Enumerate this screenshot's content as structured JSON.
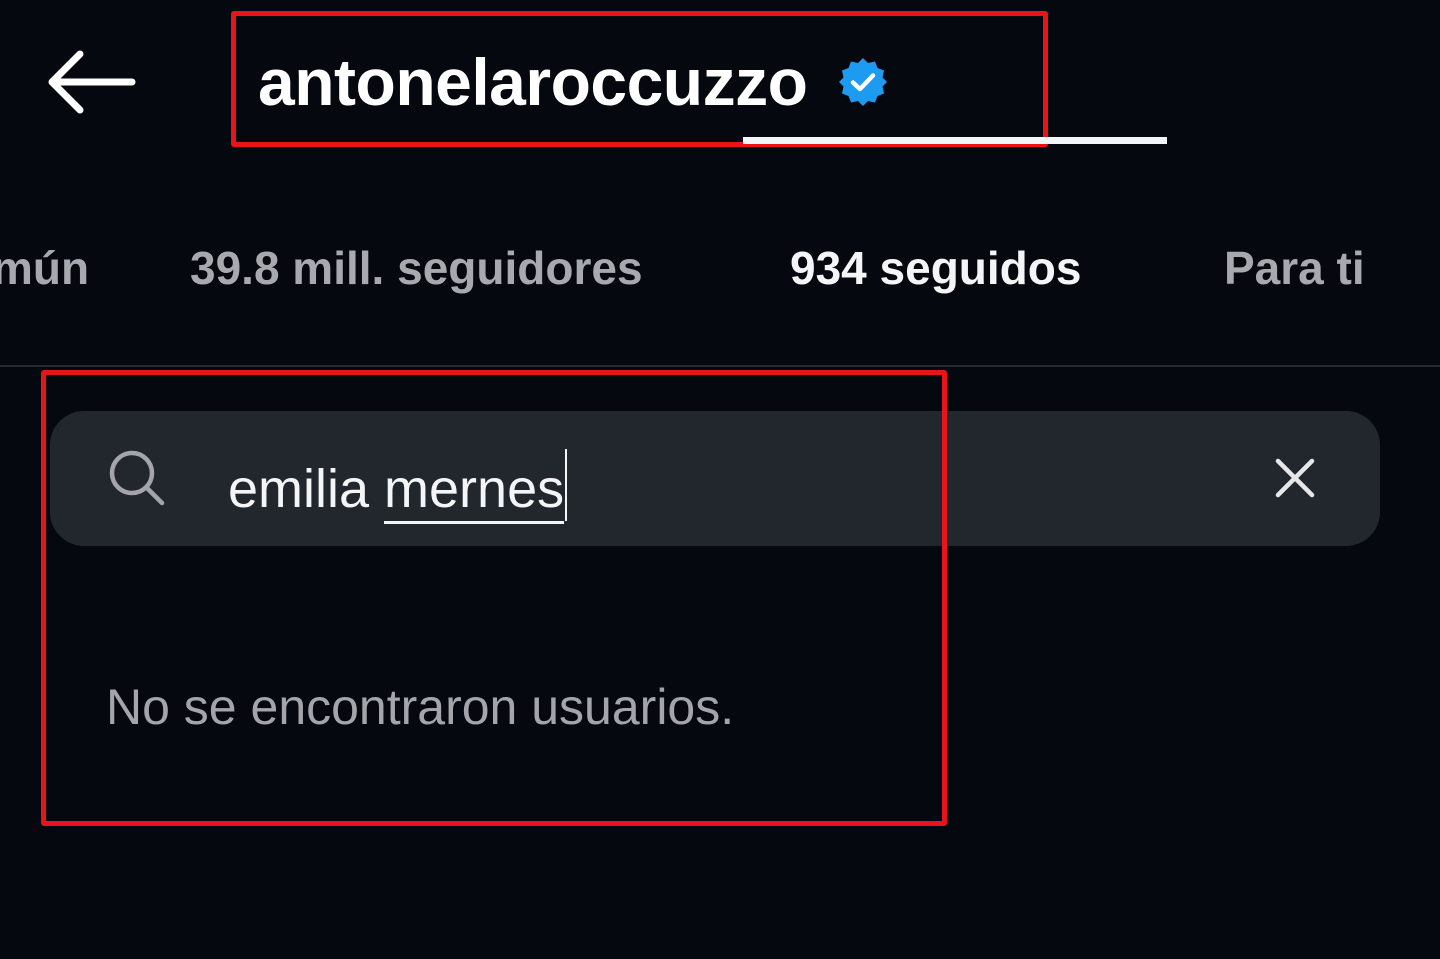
{
  "header": {
    "back_icon": "arrow-left-icon",
    "username": "antonelaroccuzzo",
    "verified_icon": "verified-badge-icon",
    "verified_color": "#1d9bf0"
  },
  "tabs": [
    {
      "label": "mún",
      "active": false
    },
    {
      "label": "39.8 mill. seguidores",
      "active": false
    },
    {
      "label": "934 seguidos",
      "active": true
    },
    {
      "label": "Para ti",
      "active": false
    }
  ],
  "search": {
    "icon": "search-icon",
    "query_plain": "emilia ",
    "query_underlined": "mernes",
    "clear_icon": "close-icon"
  },
  "results": {
    "empty_message": "No se encontraron usuarios."
  },
  "annotations": {
    "highlight_color": "#e8141c"
  }
}
